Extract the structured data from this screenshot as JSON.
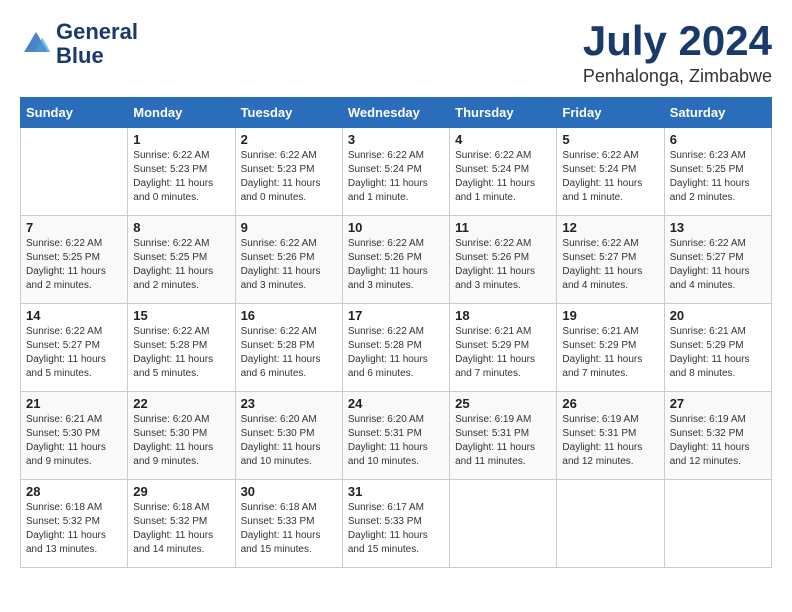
{
  "header": {
    "logo_line1": "General",
    "logo_line2": "Blue",
    "month": "July 2024",
    "location": "Penhalonga, Zimbabwe"
  },
  "days_of_week": [
    "Sunday",
    "Monday",
    "Tuesday",
    "Wednesday",
    "Thursday",
    "Friday",
    "Saturday"
  ],
  "weeks": [
    [
      {
        "day": "",
        "sunrise": "",
        "sunset": "",
        "daylight": ""
      },
      {
        "day": "1",
        "sunrise": "Sunrise: 6:22 AM",
        "sunset": "Sunset: 5:23 PM",
        "daylight": "Daylight: 11 hours and 0 minutes."
      },
      {
        "day": "2",
        "sunrise": "Sunrise: 6:22 AM",
        "sunset": "Sunset: 5:23 PM",
        "daylight": "Daylight: 11 hours and 0 minutes."
      },
      {
        "day": "3",
        "sunrise": "Sunrise: 6:22 AM",
        "sunset": "Sunset: 5:24 PM",
        "daylight": "Daylight: 11 hours and 1 minute."
      },
      {
        "day": "4",
        "sunrise": "Sunrise: 6:22 AM",
        "sunset": "Sunset: 5:24 PM",
        "daylight": "Daylight: 11 hours and 1 minute."
      },
      {
        "day": "5",
        "sunrise": "Sunrise: 6:22 AM",
        "sunset": "Sunset: 5:24 PM",
        "daylight": "Daylight: 11 hours and 1 minute."
      },
      {
        "day": "6",
        "sunrise": "Sunrise: 6:23 AM",
        "sunset": "Sunset: 5:25 PM",
        "daylight": "Daylight: 11 hours and 2 minutes."
      }
    ],
    [
      {
        "day": "7",
        "sunrise": "Sunrise: 6:22 AM",
        "sunset": "Sunset: 5:25 PM",
        "daylight": "Daylight: 11 hours and 2 minutes."
      },
      {
        "day": "8",
        "sunrise": "Sunrise: 6:22 AM",
        "sunset": "Sunset: 5:25 PM",
        "daylight": "Daylight: 11 hours and 2 minutes."
      },
      {
        "day": "9",
        "sunrise": "Sunrise: 6:22 AM",
        "sunset": "Sunset: 5:26 PM",
        "daylight": "Daylight: 11 hours and 3 minutes."
      },
      {
        "day": "10",
        "sunrise": "Sunrise: 6:22 AM",
        "sunset": "Sunset: 5:26 PM",
        "daylight": "Daylight: 11 hours and 3 minutes."
      },
      {
        "day": "11",
        "sunrise": "Sunrise: 6:22 AM",
        "sunset": "Sunset: 5:26 PM",
        "daylight": "Daylight: 11 hours and 3 minutes."
      },
      {
        "day": "12",
        "sunrise": "Sunrise: 6:22 AM",
        "sunset": "Sunset: 5:27 PM",
        "daylight": "Daylight: 11 hours and 4 minutes."
      },
      {
        "day": "13",
        "sunrise": "Sunrise: 6:22 AM",
        "sunset": "Sunset: 5:27 PM",
        "daylight": "Daylight: 11 hours and 4 minutes."
      }
    ],
    [
      {
        "day": "14",
        "sunrise": "Sunrise: 6:22 AM",
        "sunset": "Sunset: 5:27 PM",
        "daylight": "Daylight: 11 hours and 5 minutes."
      },
      {
        "day": "15",
        "sunrise": "Sunrise: 6:22 AM",
        "sunset": "Sunset: 5:28 PM",
        "daylight": "Daylight: 11 hours and 5 minutes."
      },
      {
        "day": "16",
        "sunrise": "Sunrise: 6:22 AM",
        "sunset": "Sunset: 5:28 PM",
        "daylight": "Daylight: 11 hours and 6 minutes."
      },
      {
        "day": "17",
        "sunrise": "Sunrise: 6:22 AM",
        "sunset": "Sunset: 5:28 PM",
        "daylight": "Daylight: 11 hours and 6 minutes."
      },
      {
        "day": "18",
        "sunrise": "Sunrise: 6:21 AM",
        "sunset": "Sunset: 5:29 PM",
        "daylight": "Daylight: 11 hours and 7 minutes."
      },
      {
        "day": "19",
        "sunrise": "Sunrise: 6:21 AM",
        "sunset": "Sunset: 5:29 PM",
        "daylight": "Daylight: 11 hours and 7 minutes."
      },
      {
        "day": "20",
        "sunrise": "Sunrise: 6:21 AM",
        "sunset": "Sunset: 5:29 PM",
        "daylight": "Daylight: 11 hours and 8 minutes."
      }
    ],
    [
      {
        "day": "21",
        "sunrise": "Sunrise: 6:21 AM",
        "sunset": "Sunset: 5:30 PM",
        "daylight": "Daylight: 11 hours and 9 minutes."
      },
      {
        "day": "22",
        "sunrise": "Sunrise: 6:20 AM",
        "sunset": "Sunset: 5:30 PM",
        "daylight": "Daylight: 11 hours and 9 minutes."
      },
      {
        "day": "23",
        "sunrise": "Sunrise: 6:20 AM",
        "sunset": "Sunset: 5:30 PM",
        "daylight": "Daylight: 11 hours and 10 minutes."
      },
      {
        "day": "24",
        "sunrise": "Sunrise: 6:20 AM",
        "sunset": "Sunset: 5:31 PM",
        "daylight": "Daylight: 11 hours and 10 minutes."
      },
      {
        "day": "25",
        "sunrise": "Sunrise: 6:19 AM",
        "sunset": "Sunset: 5:31 PM",
        "daylight": "Daylight: 11 hours and 11 minutes."
      },
      {
        "day": "26",
        "sunrise": "Sunrise: 6:19 AM",
        "sunset": "Sunset: 5:31 PM",
        "daylight": "Daylight: 11 hours and 12 minutes."
      },
      {
        "day": "27",
        "sunrise": "Sunrise: 6:19 AM",
        "sunset": "Sunset: 5:32 PM",
        "daylight": "Daylight: 11 hours and 12 minutes."
      }
    ],
    [
      {
        "day": "28",
        "sunrise": "Sunrise: 6:18 AM",
        "sunset": "Sunset: 5:32 PM",
        "daylight": "Daylight: 11 hours and 13 minutes."
      },
      {
        "day": "29",
        "sunrise": "Sunrise: 6:18 AM",
        "sunset": "Sunset: 5:32 PM",
        "daylight": "Daylight: 11 hours and 14 minutes."
      },
      {
        "day": "30",
        "sunrise": "Sunrise: 6:18 AM",
        "sunset": "Sunset: 5:33 PM",
        "daylight": "Daylight: 11 hours and 15 minutes."
      },
      {
        "day": "31",
        "sunrise": "Sunrise: 6:17 AM",
        "sunset": "Sunset: 5:33 PM",
        "daylight": "Daylight: 11 hours and 15 minutes."
      },
      {
        "day": "",
        "sunrise": "",
        "sunset": "",
        "daylight": ""
      },
      {
        "day": "",
        "sunrise": "",
        "sunset": "",
        "daylight": ""
      },
      {
        "day": "",
        "sunrise": "",
        "sunset": "",
        "daylight": ""
      }
    ]
  ]
}
